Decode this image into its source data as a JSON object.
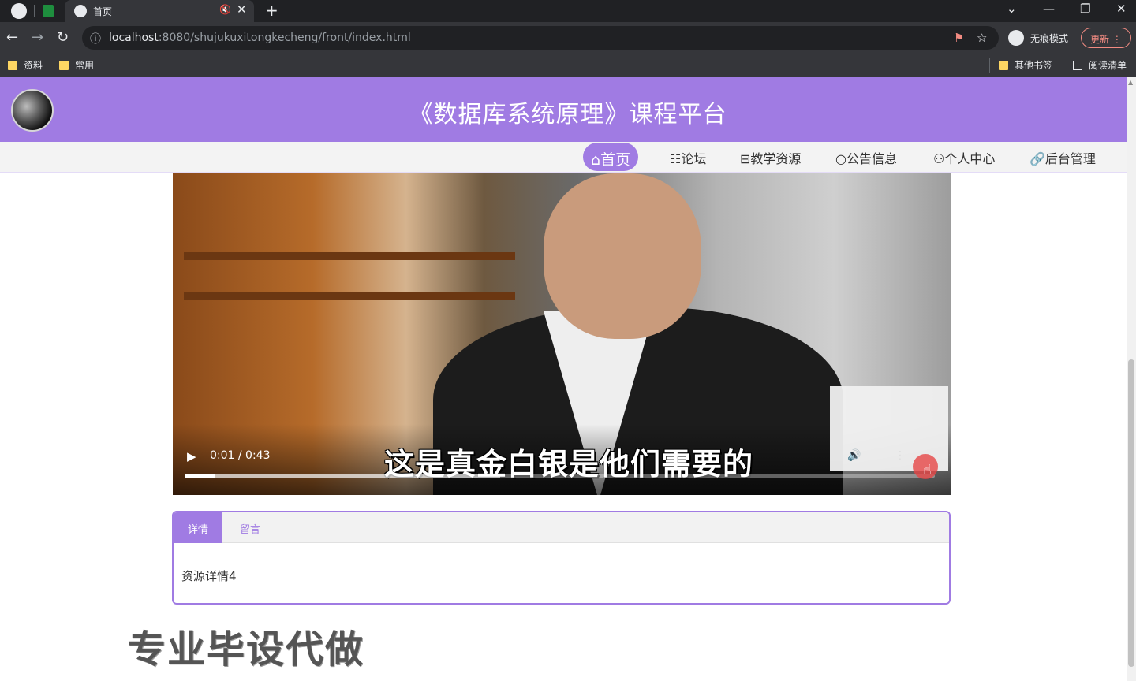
{
  "browser": {
    "tab_title": "首页",
    "url_host": "localhost",
    "url_path": ":8080/shujukuxitongkecheng/front/index.html",
    "incognito_label": "无痕模式",
    "update_label": "更新",
    "bookmarks": [
      "资料",
      "常用"
    ],
    "other_bookmarks": "其他书签",
    "reading_list": "阅读清单"
  },
  "site": {
    "title": "《数据库系统原理》课程平台",
    "nav": [
      {
        "icon": "⌂",
        "label": "首页",
        "active": true
      },
      {
        "icon": "☷",
        "label": "论坛"
      },
      {
        "icon": "⊟",
        "label": "教学资源"
      },
      {
        "icon": "○",
        "label": "公告信息"
      },
      {
        "icon": "⚇",
        "label": "个人中心"
      },
      {
        "icon": "🔗",
        "label": "后台管理"
      }
    ]
  },
  "video": {
    "time": "0:01 / 0:43",
    "subtitle": "这是真金白银是他们需要的",
    "progress": 0.04,
    "buffered": 0.42
  },
  "detail": {
    "tabs": [
      "详情",
      "留言"
    ],
    "content": "资源详情4"
  },
  "watermark": "专业毕设代做",
  "colors": {
    "accent": "#a07be3",
    "chrome_dark": "#202124",
    "chrome_mid": "#35363a"
  }
}
